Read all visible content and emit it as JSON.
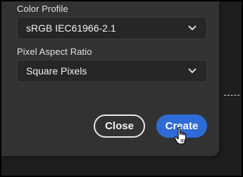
{
  "dialog": {
    "color_profile": {
      "label": "Color Profile",
      "value": "sRGB IEC61966-2.1"
    },
    "pixel_aspect_ratio": {
      "label": "Pixel Aspect Ratio",
      "value": "Square Pixels"
    },
    "buttons": {
      "close_label": "Close",
      "create_label": "Create"
    }
  },
  "colors": {
    "panel_bg": "#323232",
    "select_bg": "#262626",
    "primary_button": "#2f6bd6"
  },
  "icons": [
    "chevron-down-icon",
    "hand-pointer-cursor-icon"
  ]
}
